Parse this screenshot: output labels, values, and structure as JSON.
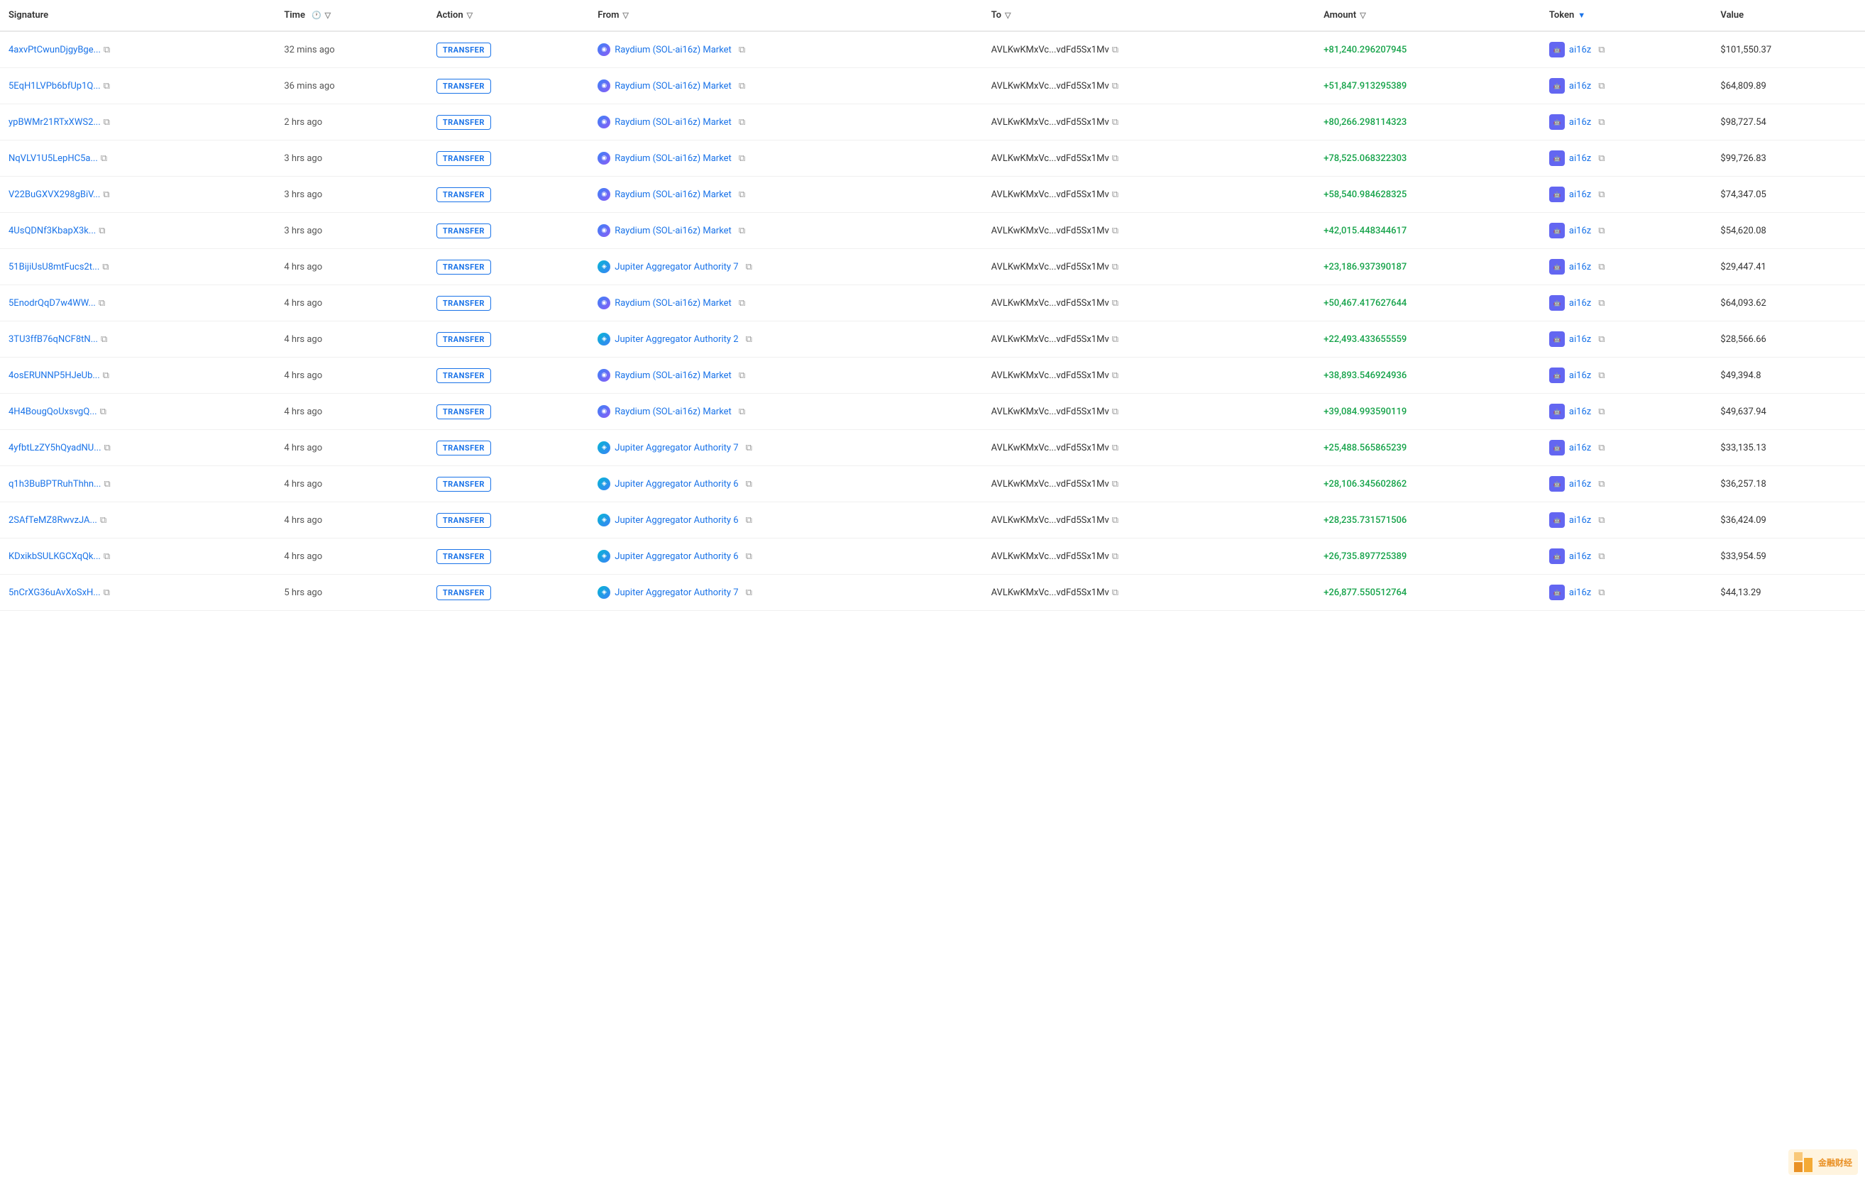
{
  "columns": {
    "signature": "Signature",
    "time": "Time",
    "action": "Action",
    "from": "From",
    "to": "To",
    "amount": "Amount",
    "token": "Token",
    "value": "Value"
  },
  "rows": [
    {
      "signature": "4axvPtCwunDjgyBge...",
      "time": "32 mins ago",
      "action": "TRANSFER",
      "from": "Raydium (SOL-ai16z) Market",
      "to": "AVLKwKMxVc...vdFd5Sx1Mv",
      "amount": "+81,240.296207945",
      "token": "ai16z",
      "value": "$101,550.37"
    },
    {
      "signature": "5EqH1LVPb6bfUp1Q...",
      "time": "36 mins ago",
      "action": "TRANSFER",
      "from": "Raydium (SOL-ai16z) Market",
      "to": "AVLKwKMxVc...vdFd5Sx1Mv",
      "amount": "+51,847.913295389",
      "token": "ai16z",
      "value": "$64,809.89"
    },
    {
      "signature": "ypBWMr21RTxXWS2...",
      "time": "2 hrs ago",
      "action": "TRANSFER",
      "from": "Raydium (SOL-ai16z) Market",
      "to": "AVLKwKMxVc...vdFd5Sx1Mv",
      "amount": "+80,266.298114323",
      "token": "ai16z",
      "value": "$98,727.54"
    },
    {
      "signature": "NqVLV1U5LepHC5a...",
      "time": "3 hrs ago",
      "action": "TRANSFER",
      "from": "Raydium (SOL-ai16z) Market",
      "to": "AVLKwKMxVc...vdFd5Sx1Mv",
      "amount": "+78,525.068322303",
      "token": "ai16z",
      "value": "$99,726.83"
    },
    {
      "signature": "V22BuGXVX298gBiV...",
      "time": "3 hrs ago",
      "action": "TRANSFER",
      "from": "Raydium (SOL-ai16z) Market",
      "to": "AVLKwKMxVc...vdFd5Sx1Mv",
      "amount": "+58,540.984628325",
      "token": "ai16z",
      "value": "$74,347.05"
    },
    {
      "signature": "4UsQDNf3KbapX3k...",
      "time": "3 hrs ago",
      "action": "TRANSFER",
      "from": "Raydium (SOL-ai16z) Market",
      "to": "AVLKwKMxVc...vdFd5Sx1Mv",
      "amount": "+42,015.448344617",
      "token": "ai16z",
      "value": "$54,620.08"
    },
    {
      "signature": "51BijiUsU8mtFucs2t...",
      "time": "4 hrs ago",
      "action": "TRANSFER",
      "from": "Jupiter Aggregator Authority 7",
      "to": "AVLKwKMxVc...vdFd5Sx1Mv",
      "amount": "+23,186.937390187",
      "token": "ai16z",
      "value": "$29,447.41"
    },
    {
      "signature": "5EnodrQqD7w4WW...",
      "time": "4 hrs ago",
      "action": "TRANSFER",
      "from": "Raydium (SOL-ai16z) Market",
      "to": "AVLKwKMxVc...vdFd5Sx1Mv",
      "amount": "+50,467.417627644",
      "token": "ai16z",
      "value": "$64,093.62"
    },
    {
      "signature": "3TU3ffB76qNCF8tN...",
      "time": "4 hrs ago",
      "action": "TRANSFER",
      "from": "Jupiter Aggregator Authority 2",
      "to": "AVLKwKMxVc...vdFd5Sx1Mv",
      "amount": "+22,493.433655559",
      "token": "ai16z",
      "value": "$28,566.66"
    },
    {
      "signature": "4osERUNNP5HJeUb...",
      "time": "4 hrs ago",
      "action": "TRANSFER",
      "from": "Raydium (SOL-ai16z) Market",
      "to": "AVLKwKMxVc...vdFd5Sx1Mv",
      "amount": "+38,893.546924936",
      "token": "ai16z",
      "value": "$49,394.8"
    },
    {
      "signature": "4H4BougQoUxsvgQ...",
      "time": "4 hrs ago",
      "action": "TRANSFER",
      "from": "Raydium (SOL-ai16z) Market",
      "to": "AVLKwKMxVc...vdFd5Sx1Mv",
      "amount": "+39,084.993590119",
      "token": "ai16z",
      "value": "$49,637.94"
    },
    {
      "signature": "4yfbtLzZY5hQyadNU...",
      "time": "4 hrs ago",
      "action": "TRANSFER",
      "from": "Jupiter Aggregator Authority 7",
      "to": "AVLKwKMxVc...vdFd5Sx1Mv",
      "amount": "+25,488.565865239",
      "token": "ai16z",
      "value": "$33,135.13"
    },
    {
      "signature": "q1h3BuBPTRuhThhn...",
      "time": "4 hrs ago",
      "action": "TRANSFER",
      "from": "Jupiter Aggregator Authority 6",
      "to": "AVLKwKMxVc...vdFd5Sx1Mv",
      "amount": "+28,106.345602862",
      "token": "ai16z",
      "value": "$36,257.18"
    },
    {
      "signature": "2SAfTeMZ8RwvzJA...",
      "time": "4 hrs ago",
      "action": "TRANSFER",
      "from": "Jupiter Aggregator Authority 6",
      "to": "AVLKwKMxVc...vdFd5Sx1Mv",
      "amount": "+28,235.731571506",
      "token": "ai16z",
      "value": "$36,424.09"
    },
    {
      "signature": "KDxikbSULKGCXqQk...",
      "time": "4 hrs ago",
      "action": "TRANSFER",
      "from": "Jupiter Aggregator Authority 6",
      "to": "AVLKwKMxVc...vdFd5Sx1Mv",
      "amount": "+26,735.897725389",
      "token": "ai16z",
      "value": "$33,954.59"
    },
    {
      "signature": "5nCrXG36uAvXoSxH...",
      "time": "5 hrs ago",
      "action": "TRANSFER",
      "from": "Jupiter Aggregator Authority 7",
      "to": "AVLKwKMxVc...vdFd5Sx1Mv",
      "amount": "+26,877.550512764",
      "token": "ai16z",
      "value": "$44,13.29"
    }
  ],
  "watermark": "金融财经"
}
